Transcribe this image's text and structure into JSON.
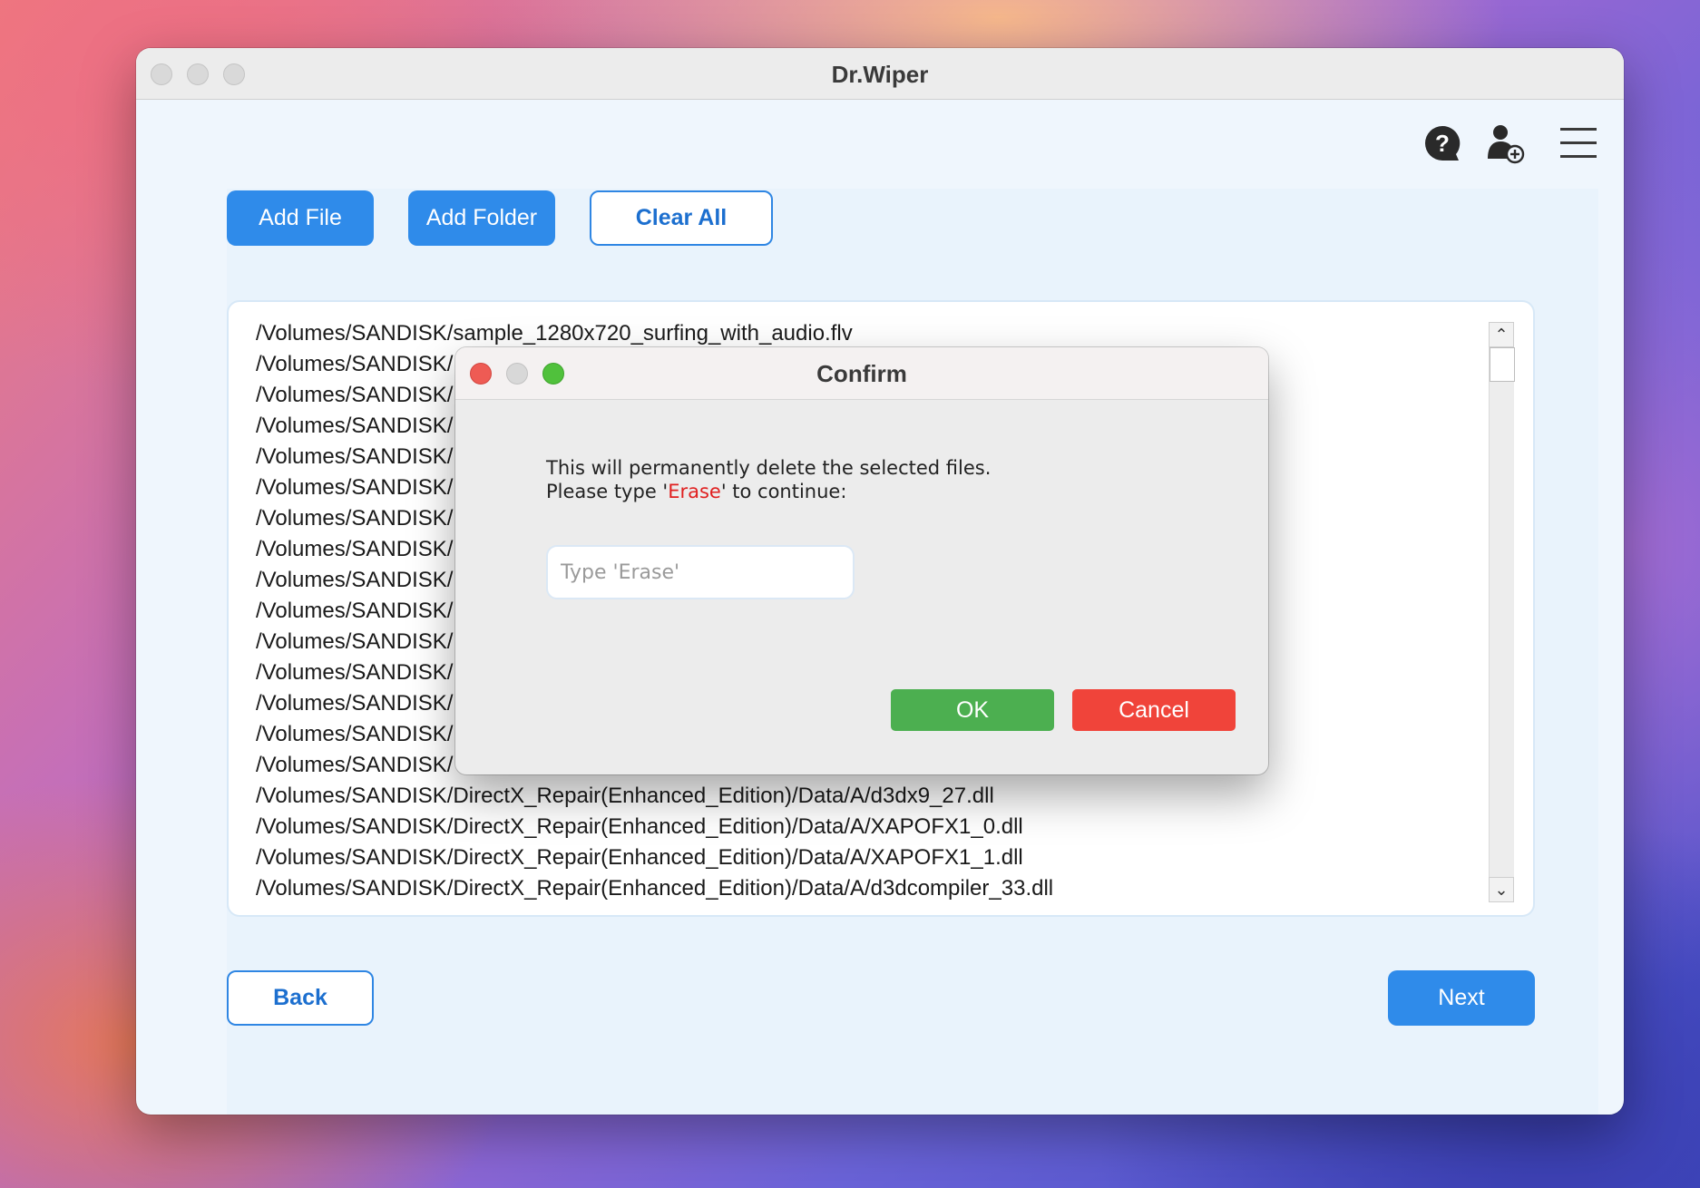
{
  "window": {
    "title": "Dr.Wiper"
  },
  "toolbar": {
    "add_file": "Add File",
    "add_folder": "Add Folder",
    "clear_all": "Clear All"
  },
  "header_icons": [
    "help-icon",
    "add-user-icon",
    "menu-icon"
  ],
  "file_list": [
    "/Volumes/SANDISK/sample_1280x720_surfing_with_audio.flv",
    "/Volumes/SANDISK/",
    "/Volumes/SANDISK/",
    "/Volumes/SANDISK/",
    "/Volumes/SANDISK/",
    "/Volumes/SANDISK/",
    "/Volumes/SANDISK/",
    "/Volumes/SANDISK/",
    "/Volumes/SANDISK/",
    "/Volumes/SANDISK/",
    "/Volumes/SANDISK/",
    "/Volumes/SANDISK/",
    "/Volumes/SANDISK/",
    "/Volumes/SANDISK/",
    "/Volumes/SANDISK/",
    "/Volumes/SANDISK/DirectX_Repair(Enhanced_Edition)/Data/A/d3dx9_27.dll",
    "/Volumes/SANDISK/DirectX_Repair(Enhanced_Edition)/Data/A/XAPOFX1_0.dll",
    "/Volumes/SANDISK/DirectX_Repair(Enhanced_Edition)/Data/A/XAPOFX1_1.dll",
    "/Volumes/SANDISK/DirectX_Repair(Enhanced_Edition)/Data/A/d3dcompiler_33.dll"
  ],
  "scrollbar": {
    "up": "⌃",
    "down": "⌄"
  },
  "footer": {
    "back": "Back",
    "next": "Next"
  },
  "dialog": {
    "title": "Confirm",
    "message_line1": "This will permanently delete the selected files.",
    "message_line2_before": "Please type '",
    "message_line2_keyword": "Erase",
    "message_line2_after": "' to continue:",
    "input_value": "",
    "input_placeholder": "Type 'Erase'",
    "ok": "OK",
    "cancel": "Cancel"
  },
  "colors": {
    "primary_blue": "#2f8bea",
    "ok_green": "#4caf50",
    "cancel_red": "#f0443a",
    "keyword_red": "#e02020",
    "close_red": "#ee5b54",
    "zoom_green": "#50c13c"
  }
}
